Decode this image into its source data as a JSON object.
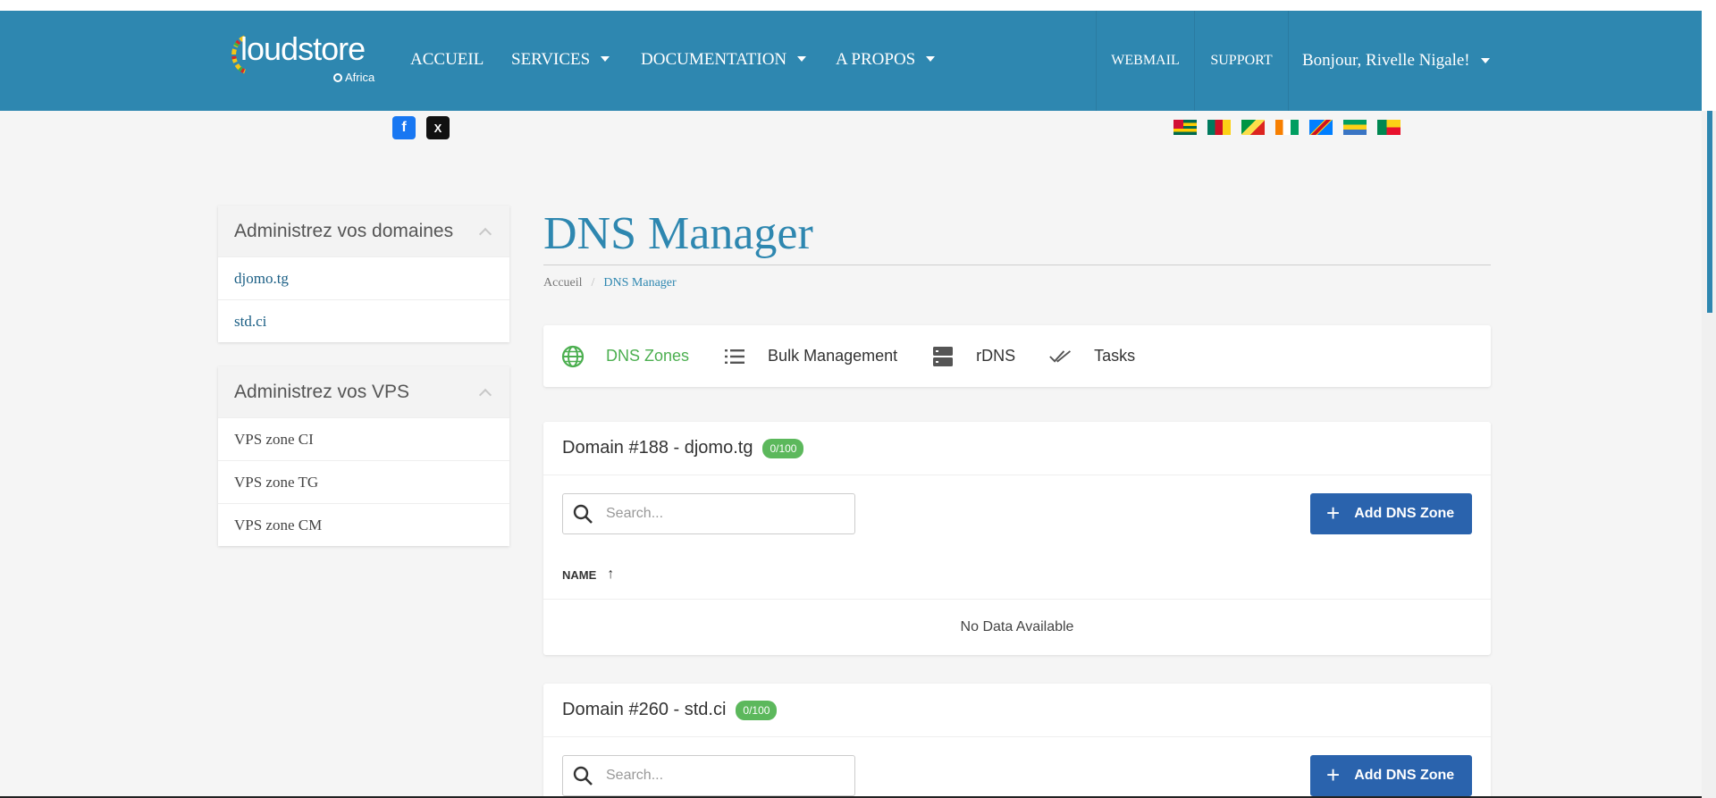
{
  "brand": {
    "logo_text": "loudstore",
    "logo_sub": "Africa"
  },
  "nav": {
    "accueil": "ACCUEIL",
    "services": "SERVICES",
    "documentation": "DOCUMENTATION",
    "apropos": "A PROPOS",
    "webmail": "WEBMAIL",
    "support": "SUPPORT",
    "user": "Bonjour, Rivelle Nigale!"
  },
  "social": {
    "facebook": "f",
    "x": "X"
  },
  "colors": {
    "header": "#2e87b0",
    "accent_green": "#4caf50",
    "button_blue": "#2a63ad",
    "badge_green": "#5cb85c"
  },
  "sidebar": {
    "domains": {
      "title": "Administrez vos domaines",
      "items": [
        "djomo.tg",
        "std.ci"
      ]
    },
    "vps": {
      "title": "Administrez vos VPS",
      "items": [
        "VPS zone CI",
        "VPS zone TG",
        "VPS zone CM"
      ]
    }
  },
  "page": {
    "title": "DNS Manager",
    "breadcrumb": {
      "home": "Accueil",
      "current": "DNS Manager"
    }
  },
  "tabs": [
    {
      "label": "DNS Zones",
      "icon": "globe-icon"
    },
    {
      "label": "Bulk Management",
      "icon": "list-icon"
    },
    {
      "label": "rDNS",
      "icon": "server-icon"
    },
    {
      "label": "Tasks",
      "icon": "double-check-icon"
    }
  ],
  "domains": [
    {
      "title": "Domain #188 - djomo.tg",
      "badge": "0/100",
      "search_placeholder": "Search...",
      "add_label": "Add DNS Zone",
      "column": "NAME",
      "empty": "No Data Available"
    },
    {
      "title": "Domain #260 - std.ci",
      "badge": "0/100",
      "search_placeholder": "Search...",
      "add_label": "Add DNS Zone"
    }
  ]
}
